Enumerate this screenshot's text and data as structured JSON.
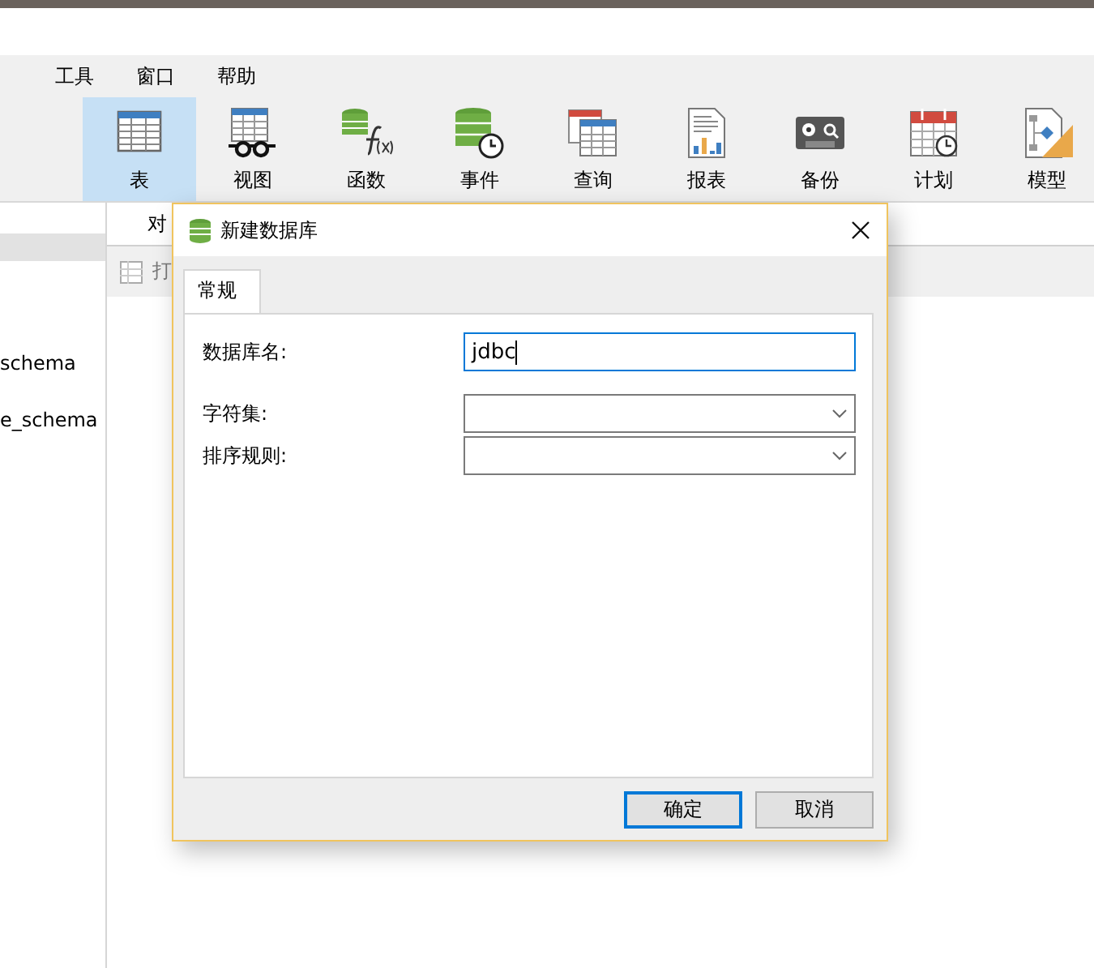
{
  "menu": [
    {
      "label": "工具"
    },
    {
      "label": "窗口"
    },
    {
      "label": "帮助"
    }
  ],
  "toolbar": [
    {
      "label": "表",
      "kind": "table",
      "selected": true
    },
    {
      "label": "视图",
      "kind": "view",
      "selected": false
    },
    {
      "label": "函数",
      "kind": "function",
      "selected": false
    },
    {
      "label": "事件",
      "kind": "event",
      "selected": false
    },
    {
      "label": "查询",
      "kind": "query",
      "selected": false
    },
    {
      "label": "报表",
      "kind": "report",
      "selected": false
    },
    {
      "label": "备份",
      "kind": "backup",
      "selected": false
    },
    {
      "label": "计划",
      "kind": "schedule",
      "selected": false
    },
    {
      "label": "模型",
      "kind": "model",
      "selected": false
    }
  ],
  "sidebar": {
    "items": [
      {
        "label": "schema"
      },
      {
        "label": "e_schema"
      }
    ]
  },
  "object_tab": {
    "label": "对"
  },
  "object_toolbar": {
    "label": "打"
  },
  "dialog": {
    "title": "新建数据库",
    "tabs": [
      {
        "label": "常规",
        "selected": true
      }
    ],
    "fields": [
      {
        "label": "数据库名:",
        "kind": "text",
        "value": "jdbc",
        "focused": true
      },
      {
        "label": "字符集:",
        "kind": "select",
        "focused": false
      },
      {
        "label": "排序规则:",
        "kind": "select",
        "focused": false
      }
    ],
    "buttons": [
      {
        "label": "确定",
        "default": true
      },
      {
        "label": "取消",
        "default": false
      }
    ]
  }
}
